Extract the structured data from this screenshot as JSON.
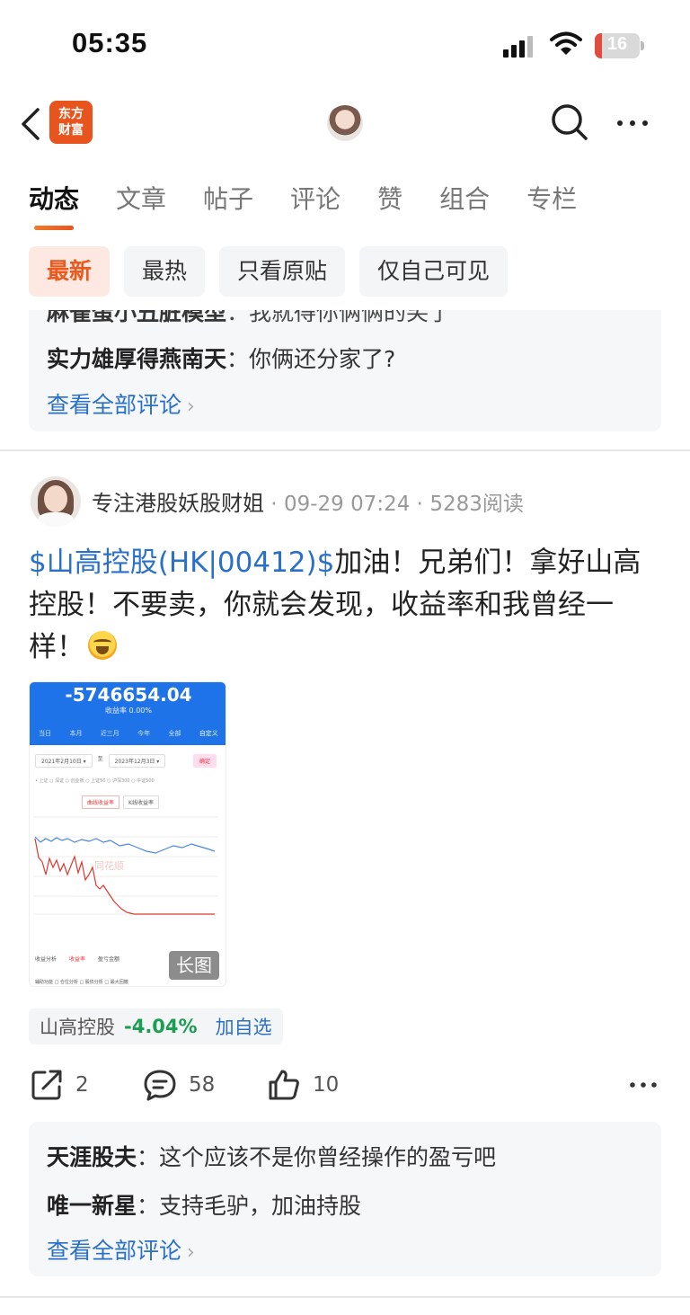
{
  "status_bar": {
    "time": "05:35",
    "battery": "16",
    "battery_level": 0.16
  },
  "header": {
    "logo_line1": "东方",
    "logo_line2": "财富"
  },
  "tabs": [
    {
      "label": "动态",
      "active": true
    },
    {
      "label": "文章"
    },
    {
      "label": "帖子"
    },
    {
      "label": "评论"
    },
    {
      "label": "赞"
    },
    {
      "label": "组合"
    },
    {
      "label": "专栏"
    }
  ],
  "filters": [
    {
      "label": "最新",
      "active": true
    },
    {
      "label": "最热"
    },
    {
      "label": "只看原贴"
    },
    {
      "label": "仅自己可见"
    }
  ],
  "prev_comments": {
    "partial_user": "麻雀蛋小丑脏模型",
    "partial_text": "我就得你俩俩的笑了",
    "items": [
      {
        "user": "实力雄厚得燕南天",
        "sep": "：",
        "text": "你俩还分家了?"
      }
    ],
    "view_all": "查看全部评论"
  },
  "post": {
    "author": "专注港股妖股财姐",
    "time": "09-29 07:24",
    "reads": "5283阅读",
    "stock_link": "$山高控股(HK|00412)$",
    "text": "加油！兄弟们！拿好山高控股！不要卖，你就会发现，收益率和我曾经一样！",
    "image": {
      "amount": "-5746654.04",
      "rate": "收益率 0.00%",
      "tabs": [
        "当日",
        "本月",
        "近三月",
        "今年",
        "全部",
        "自定义"
      ],
      "date_from": "2021年2月10日 ▾",
      "date_sep": "至",
      "date_to": "2023年12月3日 ▾",
      "confirm": "确定",
      "legend": "• 上证  ○ 深证  ○ 创业板  ○ 上证50  ○ 沪深300  ○ 中证500",
      "btn_curve": "曲线收益率",
      "btn_k": "K线收益率",
      "watermark": "同花顺",
      "foot_label": "收益分析",
      "foot_tab1": "收益率",
      "foot_tab2": "盈亏金额",
      "foot2": "辅助功能   □ 仓位分析   □ 股债分析   □ 最大回撤",
      "badge": "长图"
    },
    "stock_tag": {
      "name": "山高控股",
      "change": "-4.04%",
      "add": "加自选"
    },
    "actions": {
      "share": "2",
      "comment": "58",
      "like": "10"
    },
    "comments": [
      {
        "user": "天涯股夫",
        "sep": "：",
        "text": "这个应该不是你曾经操作的盈亏吧"
      },
      {
        "user": "唯一新星",
        "sep": "：",
        "text": "支持毛驴，加油持股"
      }
    ],
    "view_all": "查看全部评论"
  },
  "colors": {
    "accent": "#ea5a1e",
    "link": "#2a70c9",
    "down": "#1a9e52"
  }
}
